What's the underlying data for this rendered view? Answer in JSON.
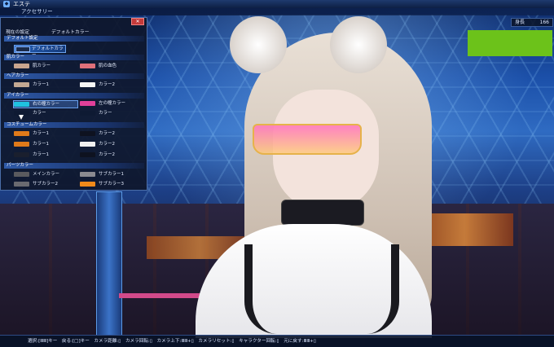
{
  "window": {
    "title": "エステ",
    "icon": "pso2-app-icon"
  },
  "subheader": {
    "title": "アクセサリー"
  },
  "height_widget": {
    "label": "身長",
    "value": "166"
  },
  "swatch_preview_color": "#6cc21a",
  "panel": {
    "close_icon": "close-icon",
    "current_setting_label": "現在の設定",
    "current_setting_value": "デフォルトカラー",
    "sections": {
      "default": {
        "title": "デフォルト設定",
        "button_label": "デフォルトカラー"
      },
      "skin": {
        "title": "肌カラー",
        "items": [
          {
            "label": "肌カラー",
            "color": "#c9a58e"
          },
          {
            "label": "肌の血色",
            "color": "#e0707a"
          }
        ]
      },
      "hair": {
        "title": "ヘアカラー",
        "items": [
          {
            "label": "カラー1",
            "color": "#c3a893"
          },
          {
            "label": "カラー2",
            "color": "#f5f5f5"
          }
        ]
      },
      "eye": {
        "title": "アイカラー",
        "items": [
          {
            "label": "右の瞳カラー",
            "color": "#1fc2e0"
          },
          {
            "label": "左の瞳カラー",
            "color": "#e0409a"
          },
          {
            "label": "カラー",
            "color": "#0e1a33"
          },
          {
            "label": "カラー",
            "color": "#0e1a33"
          }
        ]
      },
      "costume": {
        "title": "コスチュームカラー",
        "items": [
          {
            "label": "カラー1",
            "color": "#e07a1a"
          },
          {
            "label": "カラー2",
            "color": "#0e1220"
          },
          {
            "label": "カラー1",
            "color": "#e07a1a"
          },
          {
            "label": "カラー2",
            "color": "#f0f0f0"
          },
          {
            "label": "カラー1",
            "color": "#1a1f2e"
          },
          {
            "label": "カラー2",
            "color": "#0e1220"
          }
        ]
      },
      "parts": {
        "title": "パーツカラー",
        "items": [
          {
            "label": "メインカラー",
            "color": "#5a5a5e"
          },
          {
            "label": "サブカラー1",
            "color": "#8a8a90"
          },
          {
            "label": "サブカラー2",
            "color": "#6a6a70"
          },
          {
            "label": "サブカラー3",
            "color": "#f08a1a"
          }
        ]
      }
    }
  },
  "helpbar": {
    "text": "選択:[ⅢⅢ]キー　戻る:[□]キー　カメラ距離:▯　カメラ回転:▯　カメラ上下:ⅢⅢ+▯　カメラリセット:▯　キャラクター回転:▯　元に戻す:ⅢⅢ+▯"
  }
}
